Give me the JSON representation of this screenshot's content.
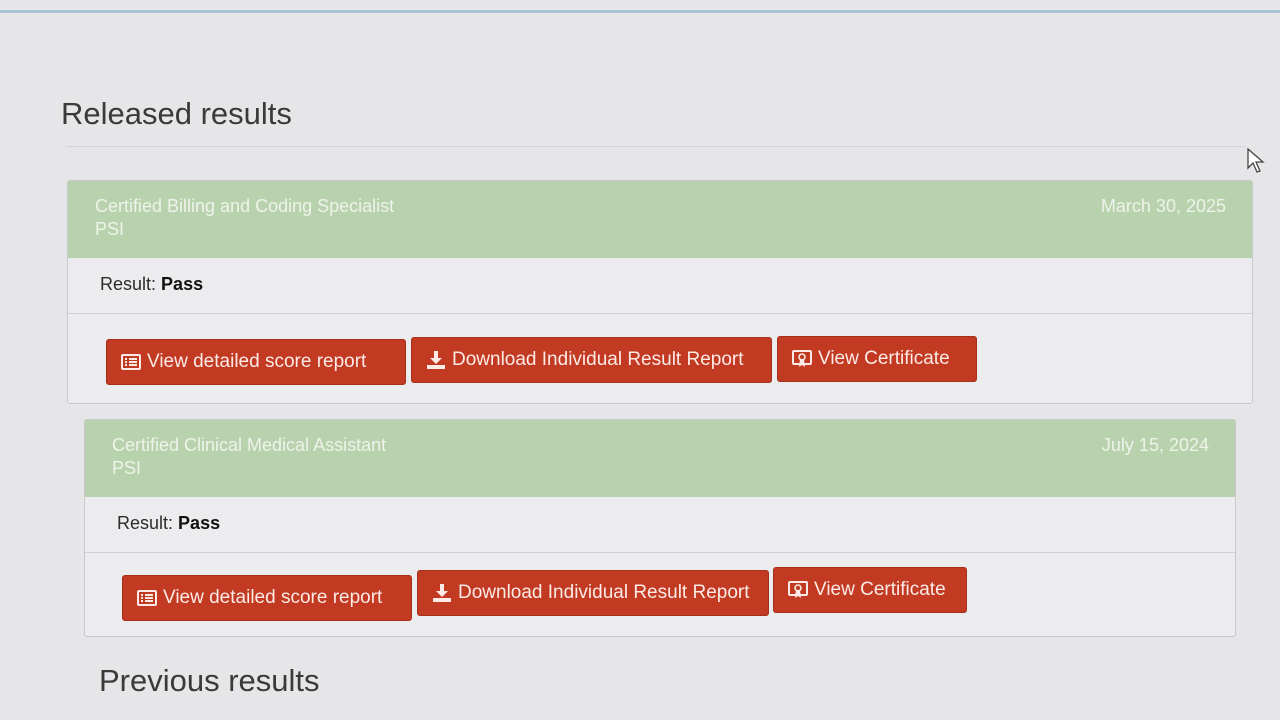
{
  "sections": {
    "released_title": "Released results",
    "previous_title": "Previous results"
  },
  "results": [
    {
      "exam": "Certified Billing and Coding Specialist",
      "provider": "PSI",
      "date": "March 30, 2025",
      "result_label": "Result:",
      "result_value": "Pass",
      "buttons": {
        "score_report": "View detailed score report",
        "download_report": "Download Individual Result Report",
        "certificate": "View Certificate"
      }
    },
    {
      "exam": "Certified Clinical Medical Assistant",
      "provider": "PSI",
      "date": "July 15, 2024",
      "result_label": "Result:",
      "result_value": "Pass",
      "buttons": {
        "score_report": "View detailed score report",
        "download_report": "Download Individual Result Report",
        "certificate": "View Certificate"
      }
    }
  ],
  "icons": {
    "score_report": "list-icon",
    "download_report": "download-icon",
    "certificate": "certificate-icon"
  },
  "colors": {
    "button": "#c23a22",
    "header": "#b9d2ae",
    "background": "#e6e6e8"
  }
}
